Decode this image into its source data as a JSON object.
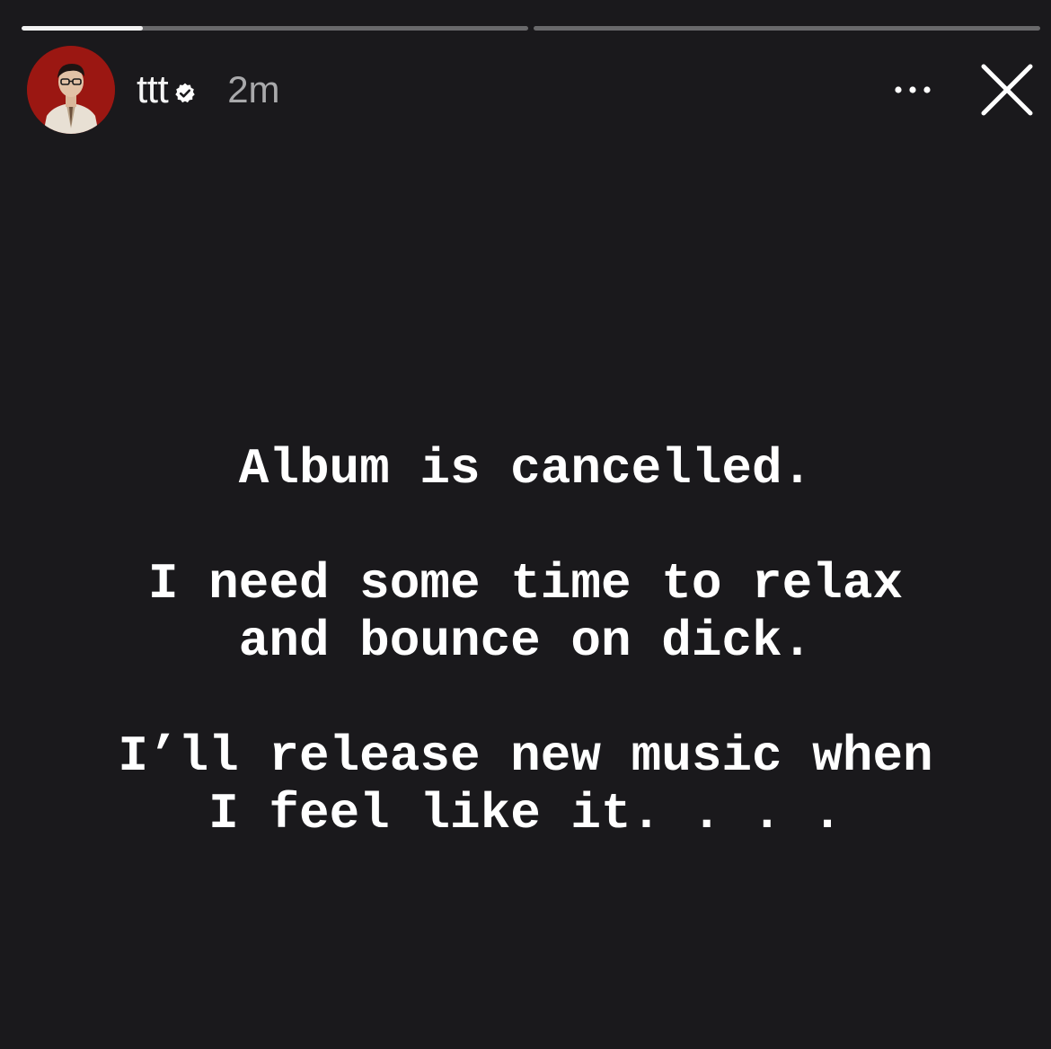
{
  "story": {
    "progress": [
      {
        "fill": 0.24
      },
      {
        "fill": 0
      }
    ],
    "header": {
      "username": "ttt",
      "timestamp": "2m",
      "verified_icon": "verified-badge-icon",
      "more_icon": "more-horizontal-icon",
      "close_icon": "close-icon"
    },
    "text": {
      "line1": "Album is cancelled.",
      "line2": "I need some time to relax",
      "line3": "and bounce on dick.",
      "line4": "I’ll release new music when",
      "line5": "I feel like it. . . ."
    }
  }
}
